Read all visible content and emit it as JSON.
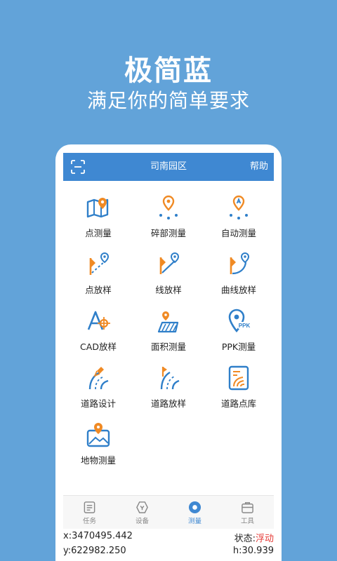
{
  "promo": {
    "title": "极简蓝",
    "subtitle": "满足你的简单要求"
  },
  "header": {
    "title": "司南园区",
    "help_label": "帮助",
    "scan_icon": "scan-icon"
  },
  "colors": {
    "background": "#62a3d9",
    "header": "#3f88d2",
    "icon_blue": "#2f7fc9",
    "icon_orange": "#f08a24",
    "state_red": "#e53935"
  },
  "tools": [
    {
      "label": "点测量",
      "icon": "map-pin-icon"
    },
    {
      "label": "碎部测量",
      "icon": "detail-survey-icon"
    },
    {
      "label": "自动测量",
      "icon": "auto-survey-icon"
    },
    {
      "label": "点放样",
      "icon": "point-stakeout-icon"
    },
    {
      "label": "线放样",
      "icon": "line-stakeout-icon"
    },
    {
      "label": "曲线放样",
      "icon": "curve-stakeout-icon"
    },
    {
      "label": "CAD放样",
      "icon": "cad-stakeout-icon"
    },
    {
      "label": "面积测量",
      "icon": "area-survey-icon"
    },
    {
      "label": "PPK测量",
      "icon": "ppk-survey-icon"
    },
    {
      "label": "道路设计",
      "icon": "road-design-icon"
    },
    {
      "label": "道路放样",
      "icon": "road-stakeout-icon"
    },
    {
      "label": "道路点库",
      "icon": "road-point-library-icon"
    },
    {
      "label": "地物测量",
      "icon": "feature-survey-icon"
    }
  ],
  "nav": [
    {
      "label": "任务",
      "icon": "task-icon",
      "active": false
    },
    {
      "label": "设备",
      "icon": "device-icon",
      "active": false
    },
    {
      "label": "测量",
      "icon": "survey-icon",
      "active": true
    },
    {
      "label": "工具",
      "icon": "toolbox-icon",
      "active": false
    }
  ],
  "status": {
    "x": "x:3470495.442",
    "y": "y:622982.250",
    "state_label": "状态:",
    "state_value": "浮动",
    "h": "h:30.939"
  }
}
